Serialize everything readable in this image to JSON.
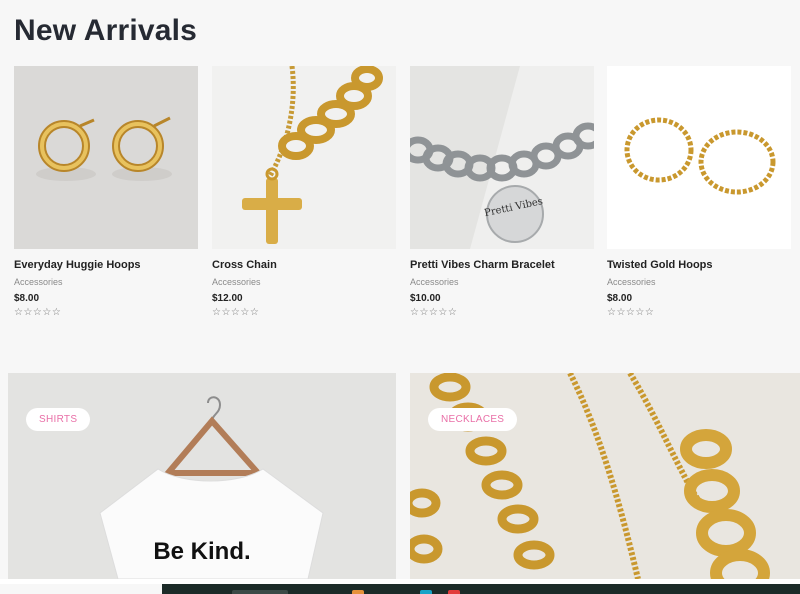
{
  "page_title": "New Arrivals",
  "products": [
    {
      "name": "Everyday Huggie Hoops",
      "category": "Accessories",
      "price": "$8.00",
      "rating": "☆☆☆☆☆"
    },
    {
      "name": "Cross Chain",
      "category": "Accessories",
      "price": "$12.00",
      "rating": "☆☆☆☆☆"
    },
    {
      "name": "Pretti Vibes Charm Bracelet",
      "category": "Accessories",
      "price": "$10.00",
      "rating": "☆☆☆☆☆",
      "charm_text": "Pretti Vibes"
    },
    {
      "name": "Twisted Gold Hoops",
      "category": "Accessories",
      "price": "$8.00",
      "rating": "☆☆☆☆☆"
    }
  ],
  "categories": [
    {
      "label": "SHIRTS",
      "shirt_text": "Be Kind."
    },
    {
      "label": "NECKLACES"
    }
  ],
  "colors": {
    "badge_text": "#e96fa7",
    "gold": "#c9982e",
    "background": "#f7f7f7"
  }
}
